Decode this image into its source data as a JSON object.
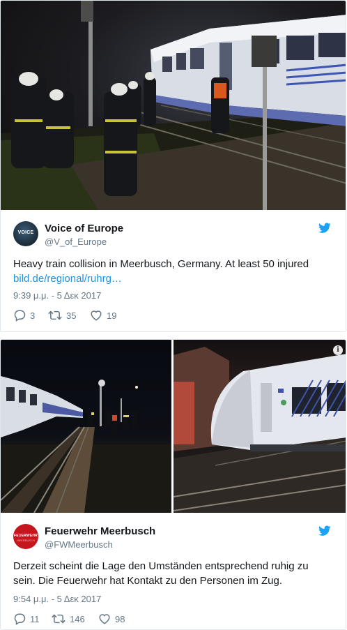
{
  "tweets": [
    {
      "author_name": "Voice of Europe",
      "handle": "@V_of_Europe",
      "avatar_text": "VOICE",
      "text": "Heavy train collision in Meerbusch, Germany. At least 50 injured",
      "link": "bild.de/regional/ruhrg…",
      "timestamp": "9:39 μ.μ. - 5 Δεκ 2017",
      "replies": "3",
      "retweets": "35",
      "likes": "19"
    },
    {
      "author_name": "Feuerwehr Meerbusch",
      "handle": "@FWMeerbusch",
      "avatar_text": "FEUERWEHR",
      "avatar_subtext": "MEERBUSCH",
      "text": "Derzeit scheint die Lage den Umständen entsprechend ruhig zu sein. Die Feuerwehr hat Kontakt zu den Personen im Zug.",
      "timestamp": "9:54 μ.μ. - 5 Δεκ 2017",
      "replies": "11",
      "retweets": "146",
      "likes": "98"
    }
  ],
  "colors": {
    "twitter_blue": "#1da1f2",
    "link_blue": "#1b95e0",
    "secondary_text": "#657786",
    "border": "#e1e8ed",
    "feuerwehr_red": "#c5161d"
  },
  "icons": [
    "reply-icon",
    "retweet-icon",
    "like-icon",
    "twitter-bird-icon",
    "info-icon"
  ]
}
